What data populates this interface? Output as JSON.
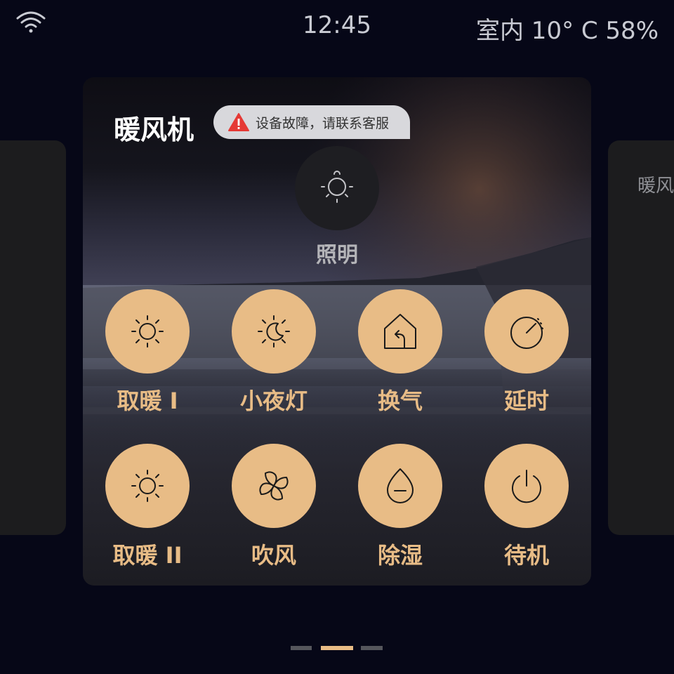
{
  "status": {
    "time": "12:45",
    "env_text": "室内 10° C 58%"
  },
  "side_right": {
    "title": "暖风"
  },
  "device": {
    "title": "暖风机",
    "fault_text": "设备故障，请联系客服",
    "light_label": "照明"
  },
  "modes": [
    {
      "label": "取暖 I",
      "icon": "sun-icon"
    },
    {
      "label": "小夜灯",
      "icon": "night-light-icon"
    },
    {
      "label": "换气",
      "icon": "ventilation-icon"
    },
    {
      "label": "延时",
      "icon": "timer-icon"
    },
    {
      "label": "取暖 II",
      "icon": "sun-icon"
    },
    {
      "label": "吹风",
      "icon": "fan-icon"
    },
    {
      "label": "除湿",
      "icon": "dehumidify-icon"
    },
    {
      "label": "待机",
      "icon": "power-icon"
    }
  ],
  "pager": {
    "total": 3,
    "active": 2
  },
  "colors": {
    "accent": "#e8bc86",
    "background": "#060717",
    "card": "#1c1c1e",
    "fault_badge": "#d8d8dc",
    "warning": "#e53935"
  }
}
